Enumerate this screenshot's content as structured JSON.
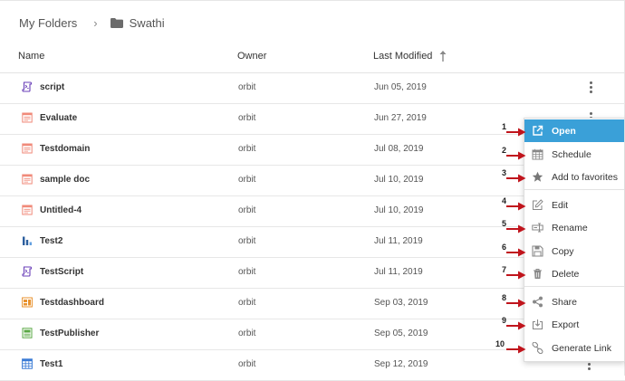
{
  "breadcrumb": {
    "root": "My Folders",
    "separator": "›",
    "current": "Swathi",
    "folder_icon": "folder-icon"
  },
  "table": {
    "headers": {
      "name": "Name",
      "owner": "Owner",
      "last_modified": "Last Modified"
    },
    "rows": [
      {
        "name": "script",
        "owner": "orbit",
        "modified": "Jun 05, 2019",
        "icon": "script-icon"
      },
      {
        "name": "Evaluate",
        "owner": "orbit",
        "modified": "Jun 27, 2019",
        "icon": "report-icon"
      },
      {
        "name": "Testdomain",
        "owner": "orbit",
        "modified": "Jul 08, 2019",
        "icon": "report-icon"
      },
      {
        "name": "sample doc",
        "owner": "orbit",
        "modified": "Jul 10, 2019",
        "icon": "report-icon"
      },
      {
        "name": "Untitled-4",
        "owner": "orbit",
        "modified": "Jul 10, 2019",
        "icon": "report-icon"
      },
      {
        "name": "Test2",
        "owner": "orbit",
        "modified": "Jul 11, 2019",
        "icon": "chart-icon"
      },
      {
        "name": "TestScript",
        "owner": "orbit",
        "modified": "Jul 11, 2019",
        "icon": "script-icon"
      },
      {
        "name": "Testdashboard",
        "owner": "orbit",
        "modified": "Sep 03, 2019",
        "icon": "dashboard-icon"
      },
      {
        "name": "TestPublisher",
        "owner": "orbit",
        "modified": "Sep 05, 2019",
        "icon": "publisher-icon"
      },
      {
        "name": "Test1",
        "owner": "orbit",
        "modified": "Sep 12, 2019",
        "icon": "table-icon"
      }
    ]
  },
  "context_menu": {
    "items": [
      {
        "label": "Open",
        "icon": "open-external-icon",
        "number": "1",
        "active": true
      },
      {
        "label": "Schedule",
        "icon": "calendar-icon",
        "number": "2"
      },
      {
        "label": "Add to favorites",
        "icon": "star-icon",
        "number": "3"
      },
      {
        "label": "Edit",
        "icon": "edit-icon",
        "number": "4"
      },
      {
        "label": "Rename",
        "icon": "rename-icon",
        "number": "5"
      },
      {
        "label": "Copy",
        "icon": "copy-icon",
        "number": "6"
      },
      {
        "label": "Delete",
        "icon": "trash-icon",
        "number": "7"
      },
      {
        "label": "Share",
        "icon": "share-icon",
        "number": "8"
      },
      {
        "label": "Export",
        "icon": "export-icon",
        "number": "9"
      },
      {
        "label": "Generate Link",
        "icon": "link-icon",
        "number": "10"
      }
    ]
  },
  "colors": {
    "accent": "#3aa0d8",
    "arrow": "#c0141c",
    "report": "#f08a7a",
    "script": "#6a3fb8",
    "chart": "#2c5f9e",
    "dashboard": "#e8922e",
    "publisher": "#5aa845",
    "table": "#3a7bd5"
  }
}
